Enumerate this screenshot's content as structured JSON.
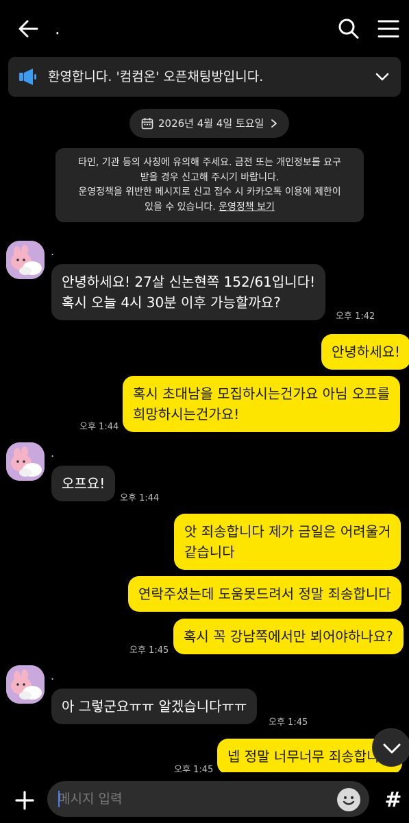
{
  "header": {
    "title": ".",
    "back_icon": "arrow-left-icon",
    "search_icon": "search-icon",
    "menu_icon": "hamburger-menu-icon"
  },
  "notice": {
    "icon": "megaphone-icon",
    "text": "환영합니다. '컴컴온' 오픈채팅방입니다.",
    "chevron": "chevron-down-icon"
  },
  "date_divider": {
    "icon": "calendar-icon",
    "text": "2026년 4월 4일 토요일",
    "chevron": "chevron-right-icon"
  },
  "warning": {
    "line1": "타인, 기관 등의 사칭에 유의해 주세요. 금전 또는 개인정보를 요구",
    "line2": "받을 경우 신고해 주시기 바랍니다.",
    "line3": "운영정책을 위반한 메시지로 신고 접수 시 카카오톡 이용에 제한이",
    "line4": "있을 수 있습니다. ",
    "link": "운영정책 보기"
  },
  "messages": [
    {
      "id": "m1",
      "dir": "in",
      "sender": ".",
      "lines": [
        "안녕하세요! 27살 신논현쪽 152/61입니다!",
        "혹시 오늘 4시 30분 이후 가능할까요?"
      ],
      "time": "오후 1:42"
    },
    {
      "id": "m2",
      "dir": "out",
      "lines": [
        "안녕하세요!"
      ],
      "time": ""
    },
    {
      "id": "m3",
      "dir": "out",
      "lines": [
        "혹시 초대남을 모집하시는건가요 아님 오프를",
        "희망하시는건가요!"
      ],
      "time": "오후 1:44"
    },
    {
      "id": "m4",
      "dir": "in",
      "sender": ".",
      "lines": [
        "오프요!"
      ],
      "time": "오후 1:44"
    },
    {
      "id": "m5",
      "dir": "out",
      "lines": [
        "앗 죄송합니다 제가 금일은 어려울거",
        "같습니다"
      ],
      "time": ""
    },
    {
      "id": "m6",
      "dir": "out",
      "lines": [
        "연락주셨는데 도움못드려서 정말 죄송합니다"
      ],
      "time": ""
    },
    {
      "id": "m7",
      "dir": "out",
      "lines": [
        "혹시 꼭 강남쪽에서만 뵈어야하나요?"
      ],
      "time": "오후 1:45"
    },
    {
      "id": "m8",
      "dir": "in",
      "sender": ".",
      "lines": [
        "아 그렇군요ㅠㅠ 알겠습니다ㅠㅠ"
      ],
      "time": "오후 1:45"
    },
    {
      "id": "m9",
      "dir": "out",
      "lines": [
        "넵 정말 너무너무 죄송합니다"
      ],
      "time": "오후 1:45"
    }
  ],
  "input": {
    "placeholder": "메시지 입력",
    "plus_icon": "plus-icon",
    "emoji_icon": "emoji-icon",
    "hash_icon": "hash-icon",
    "hash_label": "#"
  },
  "scroll_button": {
    "icon": "chevron-down-icon"
  },
  "colors": {
    "background": "#000000",
    "incoming_bubble": "#272727",
    "outgoing_bubble": "#fee500",
    "notice_bg": "#232323",
    "notice_icon": "#3d9cf0"
  }
}
